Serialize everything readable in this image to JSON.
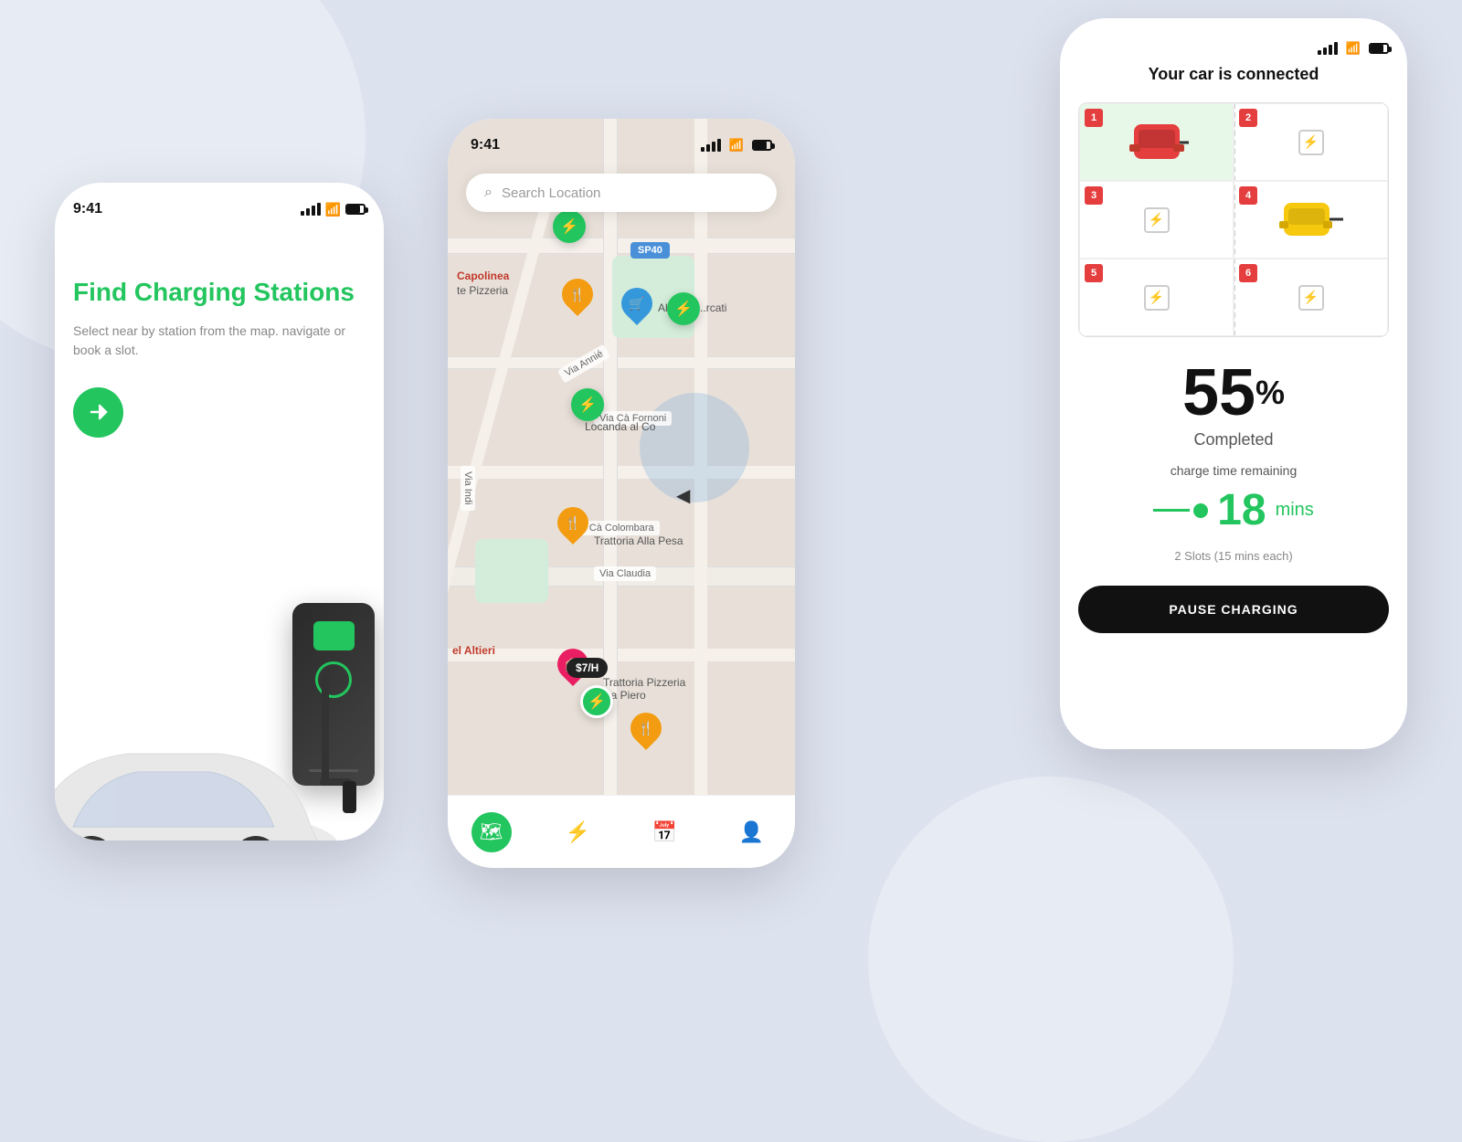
{
  "background": {
    "color": "#dde2ef"
  },
  "phone1": {
    "status_time": "9:41",
    "title": "Find Charging Stations",
    "subtitle": "Select near by station from the map.\nnavigate or book a slot.",
    "arrow_label": "→"
  },
  "phone2": {
    "status_time": "9:41",
    "search_placeholder": "Search Location",
    "map_label_sp40": "SP40",
    "road_labels": [
      "Via Annié",
      "Via Cà Fornoni",
      "Via Cà Colombara",
      "Via Claudia",
      "Via Indi"
    ],
    "places": [
      "Capolinea",
      "te Pizzeria",
      "Trattoria Alla Pesa",
      "Locanda al Co",
      "Ali supe...rcati",
      "Trattoria Pizzeria Da Piero",
      "el Altieri"
    ],
    "price_tag": "$7/H",
    "nav_items": [
      "map",
      "charge",
      "calendar",
      "profile"
    ]
  },
  "phone3": {
    "connected_title": "Your car is connected",
    "percent": "55",
    "percent_sign": "%",
    "completed_label": "Completed",
    "charge_time_label": "charge time remaining",
    "time_number": "18",
    "time_unit": "mins",
    "slots_info": "2 Slots (15 mins each)",
    "pause_button": "PAUSE CHARGING",
    "slot_numbers": [
      "1",
      "2",
      "3",
      "4",
      "5",
      "6"
    ]
  }
}
